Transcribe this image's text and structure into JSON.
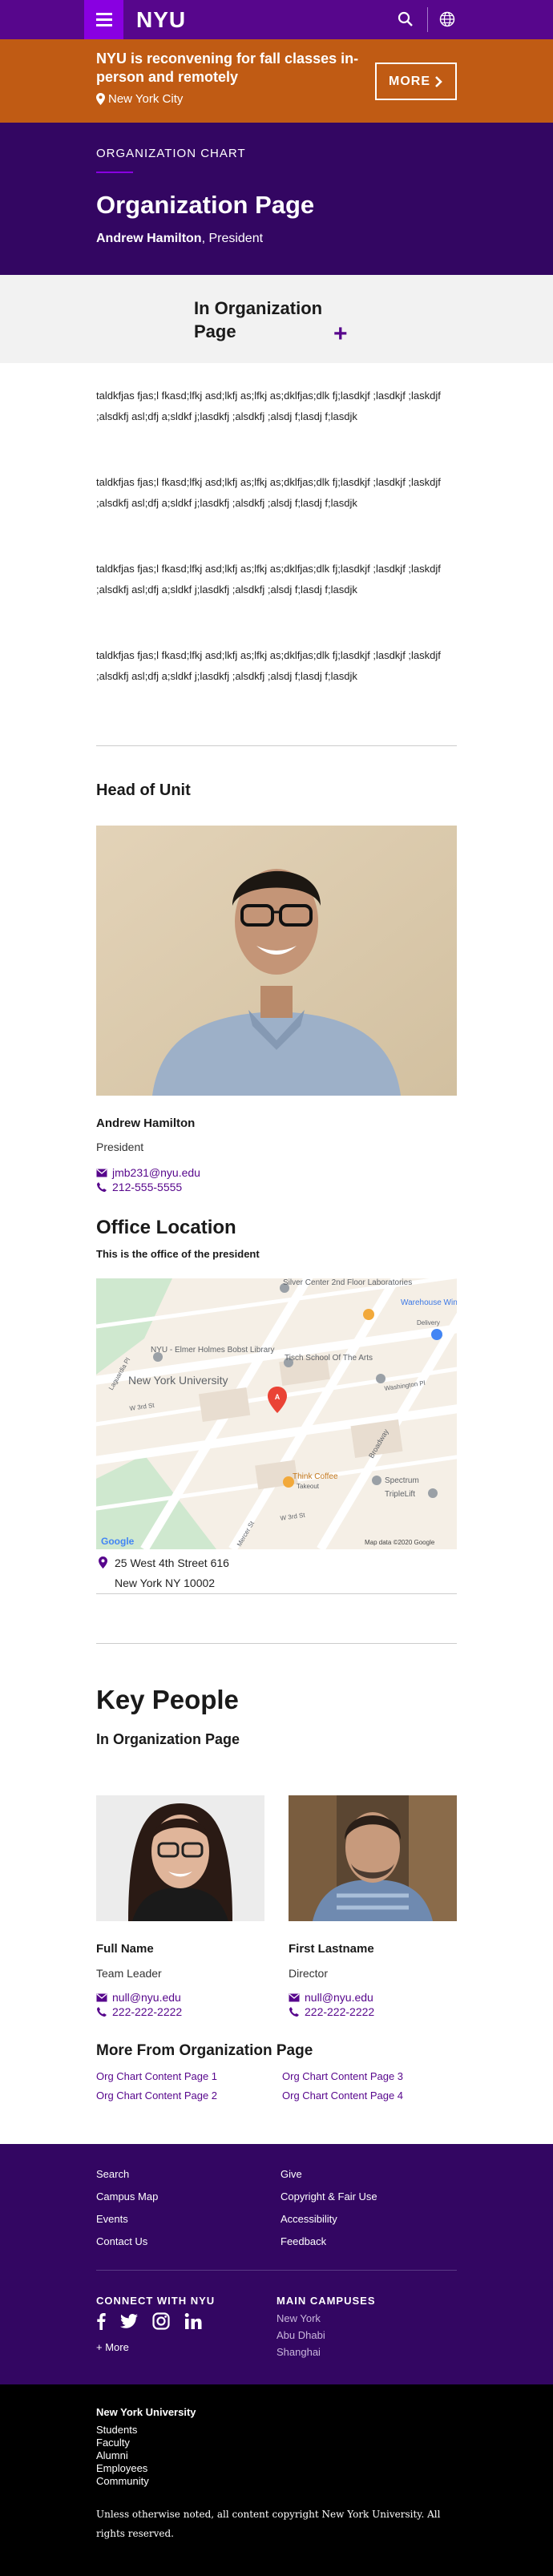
{
  "header": {
    "logo": "NYU"
  },
  "alert": {
    "title": "NYU is reconvening for fall classes in-person and remotely",
    "location": "New York City",
    "more_label": "MORE"
  },
  "hero": {
    "eyebrow": "ORGANIZATION CHART",
    "title": "Organization Page",
    "person_name": "Andrew Hamilton",
    "person_role": ", President"
  },
  "accordion": {
    "title": "In Organization Page",
    "toggle": "+"
  },
  "paragraphs": [
    "taldkfjas fjas;l fkasd;lfkj asd;lkfj as;lfkj as;dklfjas;dlk fj;lasdkjf ;lasdkjf ;laskdjf ;alsdkfj asl;dfj a;sldkf j;lasdkfj ;alsdkfj ;alsdj f;lasdj f;lasdjk",
    "taldkfjas fjas;l fkasd;lfkj asd;lkfj as;lfkj as;dklfjas;dlk fj;lasdkjf ;lasdkjf ;laskdjf ;alsdkfj asl;dfj a;sldkf j;lasdkfj ;alsdkfj ;alsdj f;lasdj f;lasdjk",
    "taldkfjas fjas;l fkasd;lfkj asd;lkfj as;lfkj as;dklfjas;dlk fj;lasdkjf ;lasdkjf ;laskdjf ;alsdkfj asl;dfj a;sldkf j;lasdkfj ;alsdkfj ;alsdj f;lasdj f;lasdjk",
    "taldkfjas fjas;l fkasd;lfkj asd;lkfj as;lfkj as;dklfjas;dlk fj;lasdkjf ;lasdkjf ;laskdjf ;alsdkfj asl;dfj a;sldkf j;lasdkfj ;alsdkfj ;alsdj f;lasdj f;lasdjk"
  ],
  "head_of_unit": {
    "heading": "Head of Unit",
    "name": "Andrew Hamilton",
    "role": "President",
    "email": "jmb231@nyu.edu",
    "phone": "212-555-5555"
  },
  "office": {
    "heading": "Office Location",
    "subtitle": "This is the office of the president",
    "map_labels": {
      "silver": "Silver Center 2nd Floor Laboratories",
      "warehouse": "Warehouse Wines & Spirits",
      "warehouse_sub": "Delivery",
      "bobst": "NYU - Elmer Holmes Bobst Library",
      "nyu": "New York University",
      "tisch": "Tisch School Of The Arts",
      "think": "Think Coffee",
      "think_sub": "Takeout",
      "spectrum": "Spectrum",
      "triplelift": "TripleLift",
      "broadway": "Broadway",
      "w3rd": "W 3rd St",
      "w3rd2": "W 3rd St",
      "washington": "Washington Pl",
      "mercer": "Mercer St",
      "laguardia": "Laguardia Pl",
      "google": "Google",
      "mapdata": "Map data ©2020 Google"
    },
    "address_line1": "25 West 4th Street 616",
    "address_line2": "New York NY 10002"
  },
  "key_people": {
    "heading": "Key People",
    "subtitle": "In Organization Page",
    "people": [
      {
        "name": "Full Name",
        "role": "Team Leader",
        "email": "null@nyu.edu",
        "phone": "222-222-2222"
      },
      {
        "name": "First Lastname",
        "role": "Director",
        "email": "null@nyu.edu",
        "phone": "222-222-2222"
      }
    ]
  },
  "more_from": {
    "heading": "More From Organization Page",
    "links": [
      "Org Chart Content Page 1",
      "Org Chart Content Page 3",
      "Org Chart Content Page 2",
      "Org Chart Content Page 4"
    ]
  },
  "footer": {
    "col1": [
      "Search",
      "Campus Map",
      "Events",
      "Contact Us"
    ],
    "col2": [
      "Give",
      "Copyright & Fair Use",
      "Accessibility",
      "Feedback"
    ],
    "connect_heading": "CONNECT WITH NYU",
    "more": "+ More",
    "campuses_heading": "MAIN CAMPUSES",
    "campuses": [
      "New York",
      "Abu Dhabi",
      "Shanghai"
    ]
  },
  "bottom": {
    "title": "New York University",
    "links": [
      "Students",
      "Faculty",
      "Alumni",
      "Employees",
      "Community"
    ],
    "copyright": "Unless otherwise noted, all content copyright New York University. All rights reserved."
  },
  "colors": {
    "brand": "#57068c",
    "brand_dark": "#330662",
    "alert": "#c05b14",
    "accent": "#8900e1"
  }
}
